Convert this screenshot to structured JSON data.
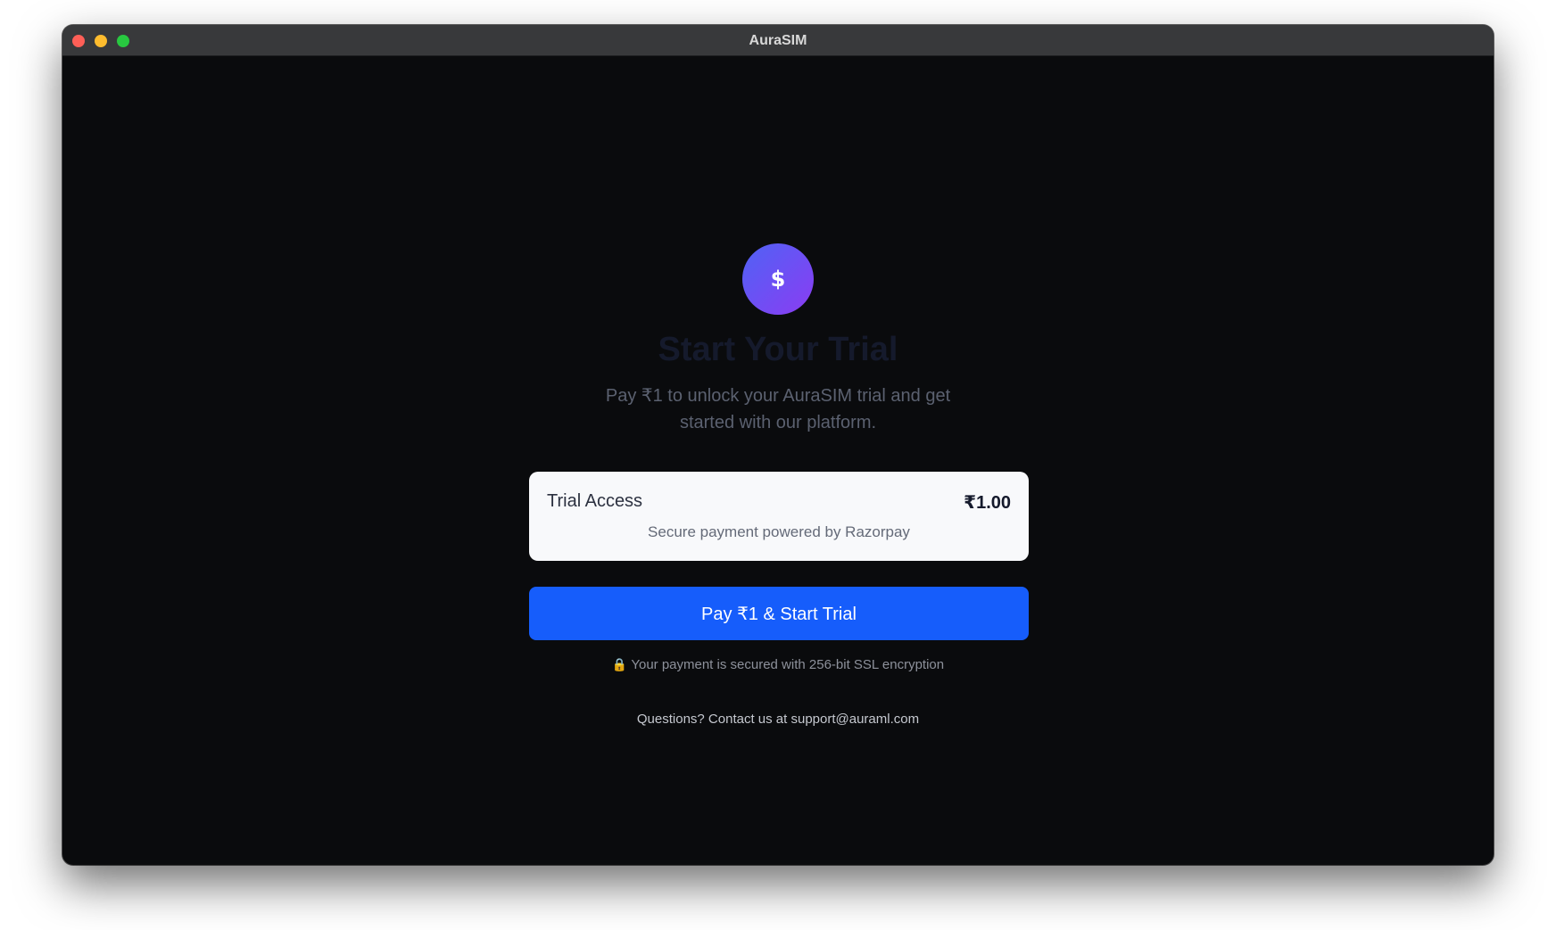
{
  "window": {
    "title": "AuraSIM"
  },
  "hero": {
    "icon": "dollar-icon",
    "icon_glyph": "$",
    "heading": "Start Your Trial",
    "subtitle": "Pay ₹1 to unlock your AuraSIM trial and get started with our platform."
  },
  "card": {
    "label": "Trial Access",
    "price": "₹1.00",
    "note": "Secure payment powered by Razorpay"
  },
  "pay_button": {
    "label": "Pay ₹1 & Start Trial"
  },
  "security": {
    "icon": "lock-icon",
    "icon_glyph": "🔒",
    "text": "Your payment is secured with 256-bit SSL encryption"
  },
  "contact": {
    "text": "Questions? Contact us at support@auraml.com"
  },
  "colors": {
    "accent": "#165dfb",
    "gradient_start": "#4f63f5",
    "gradient_end": "#8b3cf2",
    "background": "#0a0b0d"
  }
}
